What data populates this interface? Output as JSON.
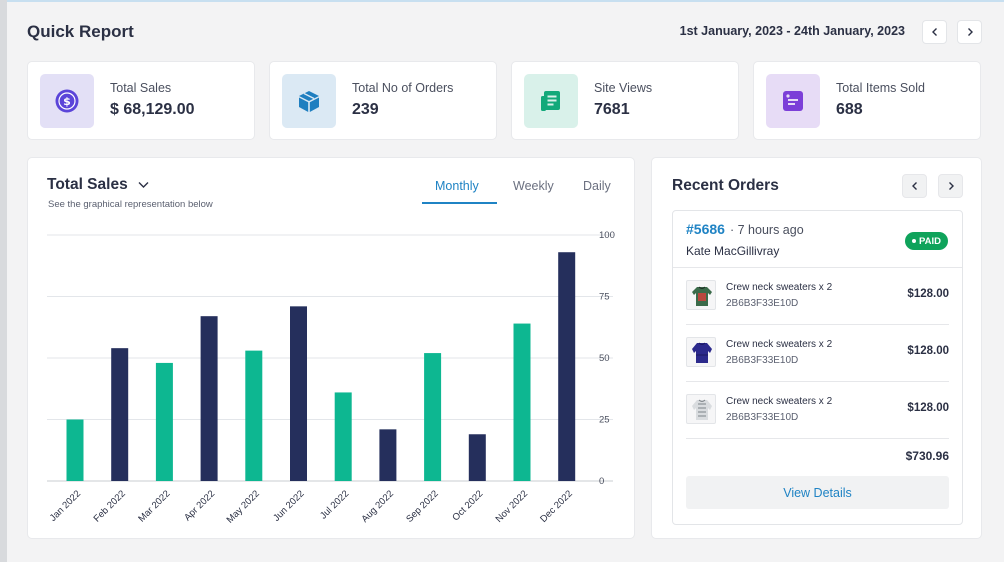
{
  "header": {
    "title": "Quick Report",
    "date_range": "1st January, 2023 - 24th January, 2023"
  },
  "stats": [
    {
      "label": "Total Sales",
      "value": "$ 68,129.00",
      "icon": "dollar-coin-icon",
      "color": "#5b45d9"
    },
    {
      "label": "Total No of Orders",
      "value": "239",
      "icon": "box-icon",
      "color": "#1f7fc0"
    },
    {
      "label": "Site Views",
      "value": "7681",
      "icon": "document-icon",
      "color": "#12a97a"
    },
    {
      "label": "Total Items Sold",
      "value": "688",
      "icon": "tag-card-icon",
      "color": "#7c3fd8"
    }
  ],
  "sales": {
    "title": "Total Sales",
    "subtitle": "See the graphical representation below",
    "tabs": [
      "Monthly",
      "Weekly",
      "Daily"
    ],
    "active_tab": "Monthly"
  },
  "chart_data": {
    "type": "bar",
    "categories": [
      "Jan 2022",
      "Feb 2022",
      "Mar 2022",
      "Apr 2022",
      "May 2022",
      "Jun 2022",
      "Jul 2022",
      "Aug 2022",
      "Sep 2022",
      "Oct 2022",
      "Nov 2022",
      "Dec 2022"
    ],
    "values": [
      25,
      54,
      48,
      67,
      53,
      71,
      36,
      21,
      52,
      19,
      64,
      93
    ],
    "colors": [
      "#0db791",
      "#252f5c",
      "#0db791",
      "#252f5c",
      "#0db791",
      "#252f5c",
      "#0db791",
      "#252f5c",
      "#0db791",
      "#252f5c",
      "#0db791",
      "#252f5c"
    ],
    "yticks": [
      "0",
      "25",
      "50",
      "75",
      "100"
    ],
    "ylim": [
      0,
      100
    ],
    "grid": true
  },
  "orders": {
    "title": "Recent Orders",
    "order_id": "#5686",
    "time": "· 7 hours ago",
    "customer": "Kate MacGillivray",
    "status": "PAID",
    "items": [
      {
        "name": "Crew neck sweaters x 2",
        "sku": "2B6B3F33E10D",
        "price": "$128.00"
      },
      {
        "name": "Crew neck sweaters x 2",
        "sku": "2B6B3F33E10D",
        "price": "$128.00"
      },
      {
        "name": "Crew neck sweaters x 2",
        "sku": "2B6B3F33E10D",
        "price": "$128.00"
      }
    ],
    "total": "$730.96",
    "view_details": "View Details"
  }
}
